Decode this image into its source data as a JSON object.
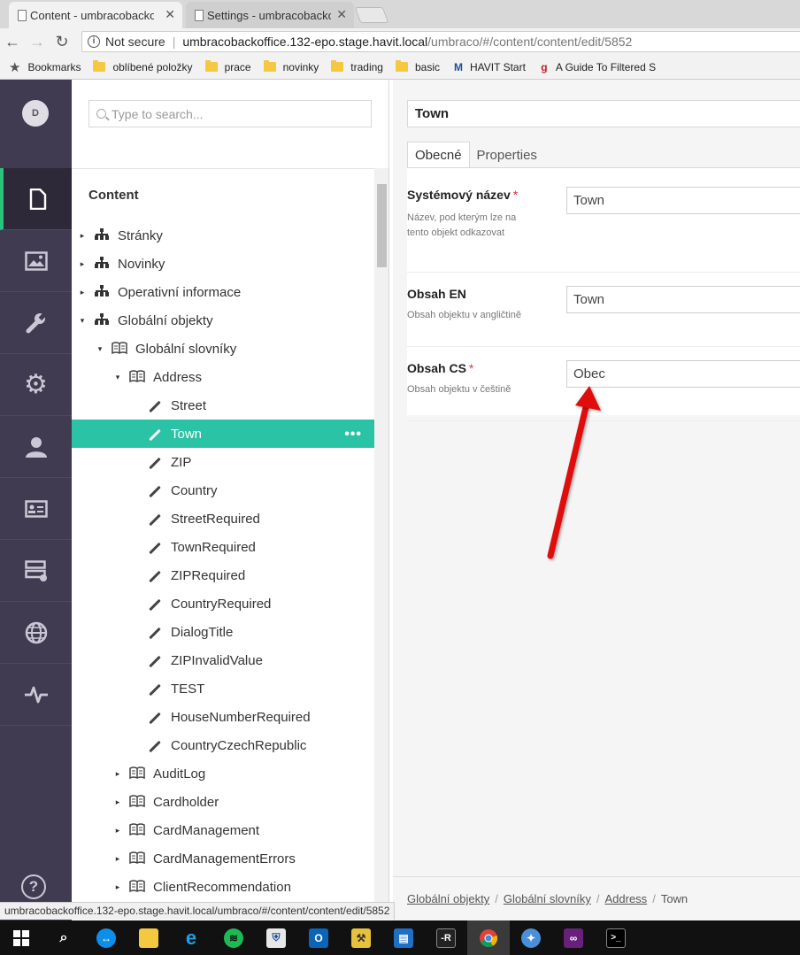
{
  "browser": {
    "tabs": [
      {
        "label": "Content - umbracobacko"
      },
      {
        "label": "Settings - umbracobacko"
      }
    ],
    "address": {
      "security": "Not secure",
      "host": "umbracobackoffice.132-epo.stage.havit.local",
      "path": "/umbraco/#/content/content/edit/5852"
    },
    "bookmarks": [
      {
        "label": "Bookmarks",
        "icon": "star-icon"
      },
      {
        "label": "oblíbené položky",
        "icon": "folder-icon"
      },
      {
        "label": "prace",
        "icon": "folder-icon"
      },
      {
        "label": "novinky",
        "icon": "folder-icon"
      },
      {
        "label": "trading",
        "icon": "folder-icon"
      },
      {
        "label": "basic",
        "icon": "folder-icon"
      },
      {
        "label": "HAVIT Start",
        "icon": "havit-icon"
      },
      {
        "label": "A Guide To Filtered S",
        "icon": "guide-icon"
      }
    ],
    "status_url": "umbracobackoffice.132-epo.stage.havit.local/umbraco/#/content/content/edit/5852"
  },
  "user": {
    "initial": "D"
  },
  "sections": [
    {
      "name": "content",
      "icon": "document-icon",
      "active": true
    },
    {
      "name": "media",
      "icon": "image-icon"
    },
    {
      "name": "settings",
      "icon": "wrench-icon"
    },
    {
      "name": "developer",
      "icon": "gear-icon"
    },
    {
      "name": "users",
      "icon": "user-icon"
    },
    {
      "name": "members",
      "icon": "id-card-icon"
    },
    {
      "name": "forms",
      "icon": "forms-icon"
    },
    {
      "name": "translation",
      "icon": "globe-icon"
    },
    {
      "name": "analytics",
      "icon": "pulse-icon"
    }
  ],
  "help": {
    "glyph": "?"
  },
  "tree": {
    "search_placeholder": "Type to search...",
    "title": "Content",
    "nodes": [
      {
        "label": "Stránky",
        "level": 0,
        "caret": "▸",
        "icon": "hierarchy"
      },
      {
        "label": "Novinky",
        "level": 0,
        "caret": "▸",
        "icon": "hierarchy"
      },
      {
        "label": "Operativní informace",
        "level": 0,
        "caret": "▸",
        "icon": "hierarchy"
      },
      {
        "label": "Globální objekty",
        "level": 0,
        "caret": "▾",
        "icon": "hierarchy"
      },
      {
        "label": "Globální slovníky",
        "level": 1,
        "caret": "▾",
        "icon": "book"
      },
      {
        "label": "Address",
        "level": 2,
        "caret": "▾",
        "icon": "book"
      },
      {
        "label": "Street",
        "level": 3,
        "caret": "",
        "icon": "pencil"
      },
      {
        "label": "Town",
        "level": 3,
        "caret": "",
        "icon": "pencil",
        "selected": true
      },
      {
        "label": "ZIP",
        "level": 3,
        "caret": "",
        "icon": "pencil"
      },
      {
        "label": "Country",
        "level": 3,
        "caret": "",
        "icon": "pencil"
      },
      {
        "label": "StreetRequired",
        "level": 3,
        "caret": "",
        "icon": "pencil"
      },
      {
        "label": "TownRequired",
        "level": 3,
        "caret": "",
        "icon": "pencil"
      },
      {
        "label": "ZIPRequired",
        "level": 3,
        "caret": "",
        "icon": "pencil"
      },
      {
        "label": "CountryRequired",
        "level": 3,
        "caret": "",
        "icon": "pencil"
      },
      {
        "label": "DialogTitle",
        "level": 3,
        "caret": "",
        "icon": "pencil"
      },
      {
        "label": "ZIPInvalidValue",
        "level": 3,
        "caret": "",
        "icon": "pencil"
      },
      {
        "label": "TEST",
        "level": 3,
        "caret": "",
        "icon": "pencil"
      },
      {
        "label": "HouseNumberRequired",
        "level": 3,
        "caret": "",
        "icon": "pencil"
      },
      {
        "label": "CountryCzechRepublic",
        "level": 3,
        "caret": "",
        "icon": "pencil"
      },
      {
        "label": "AuditLog",
        "level": 2,
        "caret": "▸",
        "icon": "book"
      },
      {
        "label": "Cardholder",
        "level": 2,
        "caret": "▸",
        "icon": "book"
      },
      {
        "label": "CardManagement",
        "level": 2,
        "caret": "▸",
        "icon": "book"
      },
      {
        "label": "CardManagementErrors",
        "level": 2,
        "caret": "▸",
        "icon": "book"
      },
      {
        "label": "ClientRecommendation",
        "level": 2,
        "caret": "▸",
        "icon": "book"
      }
    ],
    "more_glyph": "•••"
  },
  "editor": {
    "name": "Town",
    "tabs": [
      {
        "label": "Obecné",
        "active": true
      },
      {
        "label": "Properties"
      }
    ],
    "properties": [
      {
        "label": "Systémový název",
        "required": "*",
        "description": "Název, pod kterým lze na tento objekt odkazovat",
        "value": "Town"
      },
      {
        "label": "Obsah EN",
        "required": "",
        "description": "Obsah objektu v angličtině",
        "value": "Town"
      },
      {
        "label": "Obsah CS",
        "required": "*",
        "description": "Obsah objektu v češtině",
        "value": "Obec"
      }
    ],
    "breadcrumb": [
      "Globální objekty",
      "Globální slovníky",
      "Address",
      "Town"
    ]
  },
  "colors": {
    "section_bar": "#413b51",
    "section_active_accent": "#2bc37c",
    "tree_selected": "#2bc3a5",
    "required_star": "#e0334a",
    "annotation_arrow": "#e01010"
  },
  "taskbar": [
    {
      "name": "start",
      "icon": "windows-icon"
    },
    {
      "name": "search",
      "icon": "search-icon"
    },
    {
      "name": "teamviewer",
      "icon": "teamviewer-icon"
    },
    {
      "name": "explorer",
      "icon": "folder-icon"
    },
    {
      "name": "ie",
      "icon": "ie-icon"
    },
    {
      "name": "spotify",
      "icon": "spotify-icon"
    },
    {
      "name": "security",
      "icon": "shield-icon"
    },
    {
      "name": "outlook",
      "icon": "outlook-icon"
    },
    {
      "name": "tools",
      "icon": "tools-icon"
    },
    {
      "name": "app",
      "icon": "window-icon"
    },
    {
      "name": "resharper",
      "icon": "resharper-icon"
    },
    {
      "name": "chrome",
      "icon": "chrome-icon",
      "active": true
    },
    {
      "name": "fiddler",
      "icon": "fiddler-icon"
    },
    {
      "name": "visual-studio",
      "icon": "visual-studio-icon"
    },
    {
      "name": "terminal",
      "icon": "terminal-icon"
    }
  ]
}
